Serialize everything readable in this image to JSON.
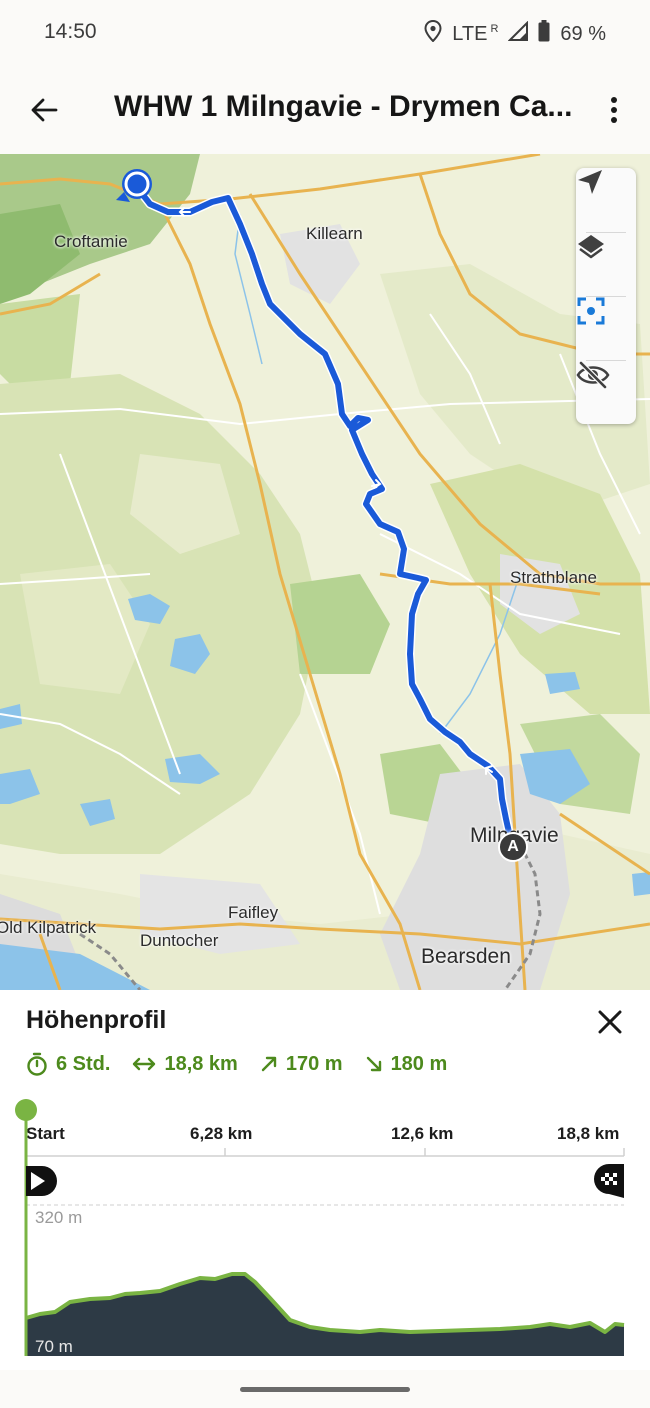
{
  "status": {
    "time": "14:50",
    "network": "LTE",
    "roaming": "R",
    "battery": "69 %"
  },
  "appbar": {
    "title": "WHW 1 Milngavie - Drymen Ca..."
  },
  "map": {
    "places": {
      "croftamie": "Croftamie",
      "killearn": "Killearn",
      "strathblane": "Strathblane",
      "milngavie": "Milngavie",
      "faifley": "Faifley",
      "old_kilpatrick": "Old Kilpatrick",
      "duntocher": "Duntocher",
      "bearsden": "Bearsden"
    },
    "start_marker": "A",
    "route_color": "#1a5ad8"
  },
  "sheet": {
    "title": "Höhenprofil",
    "stats": {
      "duration": "6 Std.",
      "distance": "18,8 km",
      "ascent": "170 m",
      "descent": "180 m"
    },
    "axis": {
      "start": "Start",
      "mid1": "6,28 km",
      "mid2": "12,6 km",
      "end": "18,8 km"
    },
    "elevation": {
      "max_label": "320 m",
      "min_label": "70 m"
    },
    "accent": "#4d8a1d"
  }
}
